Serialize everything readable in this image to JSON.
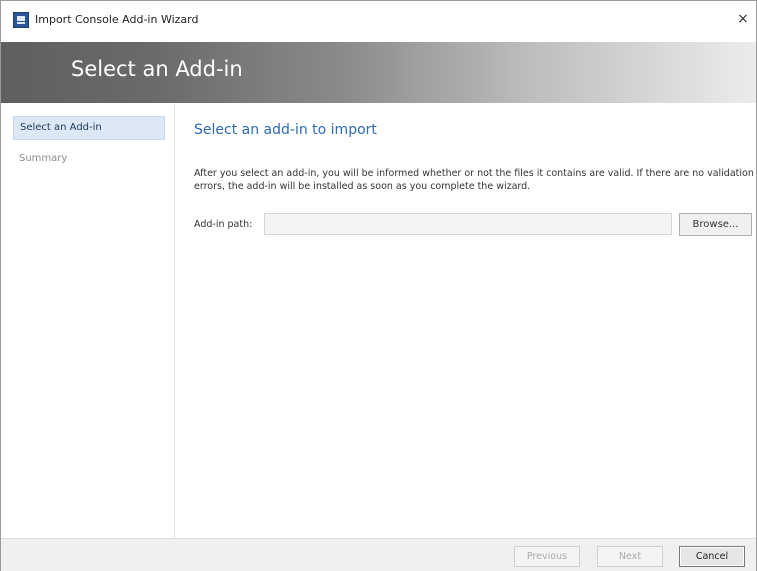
{
  "window": {
    "title": "Import Console Add-in Wizard",
    "close_glyph": "×",
    "icon": "wizard-app-icon"
  },
  "banner": {
    "title": "Select an Add-in"
  },
  "sidebar": {
    "items": [
      {
        "label": "Select an Add-in",
        "state": "active"
      },
      {
        "label": "Summary",
        "state": "inactive"
      }
    ]
  },
  "main": {
    "heading": "Select an add-in to import",
    "description": "After you select an add-in, you will be informed whether or not the files it contains are valid. If there are no validation errors, the add-in will be installed as soon as you complete the wizard.",
    "path_label": "Add-in path:",
    "path_value": "",
    "browse_label": "Browse..."
  },
  "footer": {
    "previous_label": "Previous",
    "next_label": "Next",
    "cancel_label": "Cancel"
  },
  "colors": {
    "accent_heading": "#2e6bb5",
    "nav_active_bg": "#dce8f6",
    "banner_dark": "#5f5f5f"
  }
}
